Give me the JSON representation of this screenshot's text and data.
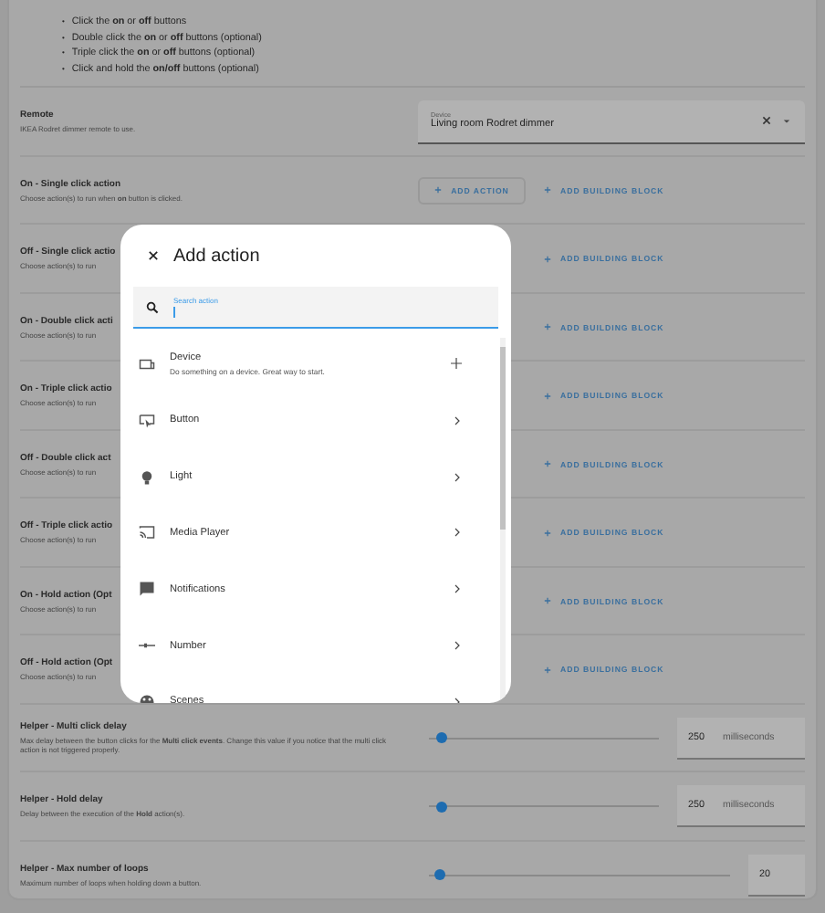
{
  "instructions": [
    {
      "marker": "•",
      "text": "Click the **on** or **off** buttons"
    },
    {
      "marker": "•",
      "text": "Double click the **on** or **off** buttons (optional)"
    },
    {
      "marker": "•",
      "text": "Triple click the **on** or **off** buttons (optional)"
    },
    {
      "marker": "•",
      "text": "Click and hold the **on/off** buttons (optional)"
    }
  ],
  "remote": {
    "title": "Remote",
    "description": "IKEA Rodret dimmer remote to use.",
    "device_label": "Device",
    "device_value": "Living room Rodret dimmer"
  },
  "action_rows": [
    {
      "title": "On - Single click action",
      "description": "Choose action(s) to run when **on** button is clicked.",
      "add_action": "ADD ACTION",
      "add_block": "ADD BUILDING BLOCK"
    },
    {
      "title": "Off - Single click actio",
      "description": "Choose action(s) to run",
      "add_block": "ADD BUILDING BLOCK"
    },
    {
      "title": "On - Double click acti",
      "description": "Choose action(s) to run",
      "add_block": "ADD BUILDING BLOCK"
    },
    {
      "title": "On - Triple click actio",
      "description": "Choose action(s) to run",
      "add_block": "ADD BUILDING BLOCK"
    },
    {
      "title": "Off - Double click act",
      "description": "Choose action(s) to run",
      "add_block": "ADD BUILDING BLOCK"
    },
    {
      "title": "Off - Triple click actio",
      "description": "Choose action(s) to run",
      "add_block": "ADD BUILDING BLOCK"
    },
    {
      "title": "On - Hold action (Opt",
      "description": "Choose action(s) to run",
      "add_block": "ADD BUILDING BLOCK"
    },
    {
      "title": "Off - Hold action (Opt",
      "description": "Choose action(s) to run",
      "add_block": "ADD BUILDING BLOCK"
    }
  ],
  "helpers": [
    {
      "title": "Helper - Multi click delay",
      "description": "Max delay between the button clicks for the **Multi click events**. Change this value if you notice that the multi click action is not triggered properly.",
      "level": 0.03,
      "value": "250",
      "unit": "milliseconds"
    },
    {
      "title": "Helper - Hold delay",
      "description": "Delay between the execution of the **Hold** action(s).",
      "level": 0.03,
      "value": "250",
      "unit": "milliseconds"
    },
    {
      "title": "Helper - Max number of loops",
      "description": "Maximum number of loops when holding down a button.",
      "level": 0.02,
      "value": "20"
    }
  ],
  "dialog": {
    "title": "Add action",
    "search_label": "Search action",
    "items": [
      {
        "kind": "add",
        "label": "Device",
        "subtitle": "Do something on a device. Great way to start."
      },
      {
        "kind": "group",
        "label": "Button"
      },
      {
        "kind": "group",
        "label": "Light"
      },
      {
        "kind": "group",
        "label": "Media Player"
      },
      {
        "kind": "group",
        "label": "Notifications"
      },
      {
        "kind": "group",
        "label": "Number"
      },
      {
        "kind": "group",
        "label": "Scenes"
      }
    ]
  }
}
